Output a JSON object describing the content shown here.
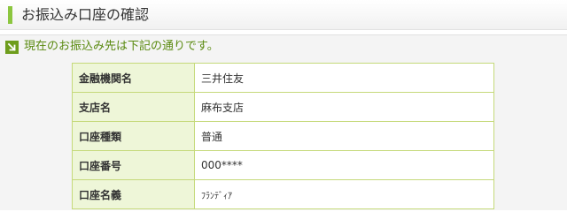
{
  "header": {
    "title": "お振込み口座の確認"
  },
  "section": {
    "heading": "現在のお振込み先は下記の通りです。",
    "icon": "arrow-down-right-icon"
  },
  "account": {
    "rows": [
      {
        "label": "金融機関名",
        "value": "三井住友"
      },
      {
        "label": "支店名",
        "value": "麻布支店"
      },
      {
        "label": "口座種類",
        "value": "普通"
      },
      {
        "label": "口座番号",
        "value": "000****"
      },
      {
        "label": "口座名義",
        "value": "ﾌﾗﾝﾃﾞｨｱ"
      }
    ]
  },
  "colors": {
    "accent": "#8cc63f",
    "icon_bg": "#6e9d1c",
    "heading_text": "#5a8a10",
    "label_bg": "#eef6d8",
    "border": "#c5d97a"
  }
}
